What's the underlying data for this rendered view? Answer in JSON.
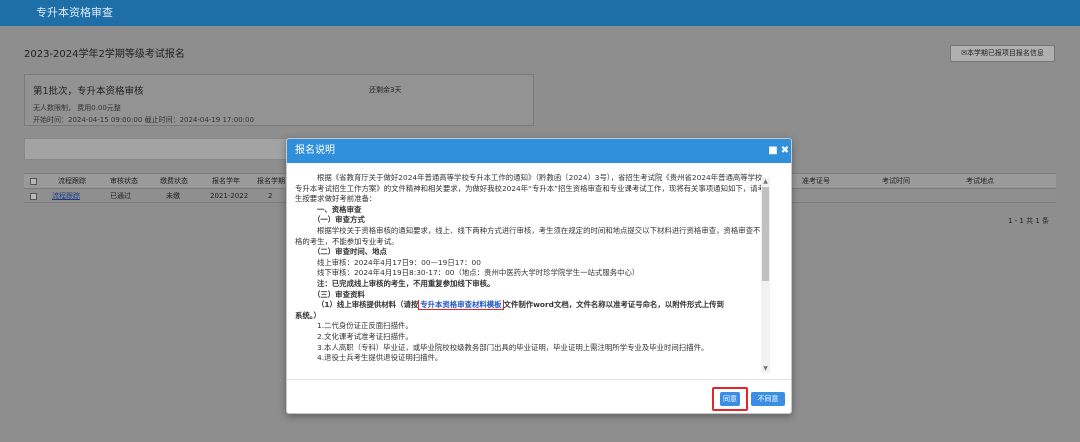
{
  "topbar": {
    "title": "专升本资格审查"
  },
  "page": {
    "title": "2023-2024学年2学期等级考试报名",
    "top_button": "本学期已报项目报名信息",
    "batch": {
      "title": "第1批次，专升本资格审核",
      "remaining": "还剩余3天",
      "line1": "无人数限制， 费用0.00元整",
      "line2": "开始时间：2024-04-15 09:00:00  截止时间：2024-04-19 17:00:00"
    },
    "table": {
      "columns": [
        "流程跟踪",
        "审核状态",
        "缴费状态",
        "报名学年",
        "报名学期",
        "准考证号",
        "考试时间",
        "考试地点"
      ],
      "rows": [
        {
          "track": "流程跟踪",
          "audit": "已通过",
          "pay": "未缴",
          "year": "2021-2022",
          "term": "2"
        }
      ],
      "pager": "1 - 1  共 1 条"
    }
  },
  "modal": {
    "title": "报名说明",
    "min_icon": "■",
    "close_icon": "✖",
    "paragraph1": "根据《省教育厅关于做好2024年普通高等学校专升本工作的通知》（黔教函〔2024〕3号），省招生考试院《贵州省2024年普通高等学校专升本考试招生工作方案》的文件精神和相关要求，为做好我校2024年“专升本”招生资格审查和专业课考试工作，现将有关事项通知如下，请考生按要求做好考前准备：",
    "s1": "一、资格审查",
    "s1_1": "（一）审查方式",
    "p_method": "根据学校关于资格审核的通知要求，线上、线下两种方式进行审核，考生须在规定的时间和地点提交以下材料进行资格审查，资格审查不合格的考生，不能参加专业考试。",
    "s1_2": "（二）审查时间、地点",
    "online": "线上审核：2024年4月17日9：00—19日17：00",
    "offline": "线下审核：2024年4月19日8:30-17：00（地点：贵州中医药大学时珍学院学生一站式服务中心）",
    "note": "注：已完成线上审核的考生，不用重复参加线下审核。",
    "s1_3": "（三）审查资料",
    "m1_prefix": "（1）线上审核提供材料（请按",
    "m1_link": "专升本资格审查材料模板",
    "m1_suffix": "文件制作word文档，文件名称以准考证号命名，以附件形式上传到",
    "m1_cont": "系统。）",
    "i1": "1.二代身份证正反面扫描件。",
    "i2": "2.文化课考试准考证扫描件。",
    "i3": "3.本人高职（专科）毕业证，或毕业院校校级教务部门出具的毕业证明，毕业证明上需注明所学专业及毕业时间扫描件。",
    "i4": "4.退役士兵考生提供退役证明扫描件。",
    "agree": "同意",
    "disagree": "不同意"
  }
}
